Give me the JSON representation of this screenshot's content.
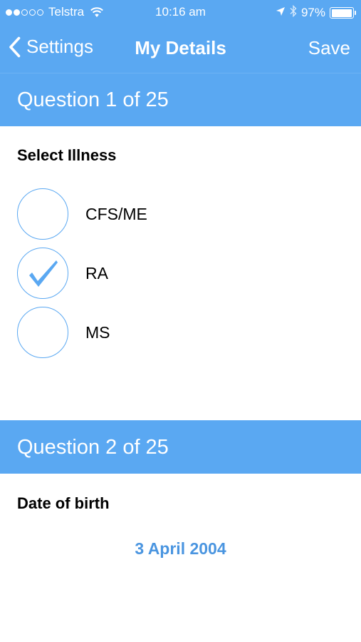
{
  "status_bar": {
    "carrier": "Telstra",
    "signal_bars": 5,
    "signal_filled": 2,
    "time": "10:16 am",
    "battery_percent": "97%",
    "battery_level": 0.97
  },
  "nav": {
    "back_label": "Settings",
    "title": "My Details",
    "save_label": "Save"
  },
  "questions": [
    {
      "header": "Question 1 of 25",
      "label": "Select Illness",
      "options": [
        {
          "label": "CFS/ME",
          "selected": false
        },
        {
          "label": "RA",
          "selected": true
        },
        {
          "label": "MS",
          "selected": false
        }
      ]
    },
    {
      "header": "Question 2 of 25",
      "label": "Date of birth",
      "value": "3 April 2004"
    }
  ],
  "colors": {
    "accent": "#5aa8f2",
    "value_text": "#4a95e0"
  }
}
